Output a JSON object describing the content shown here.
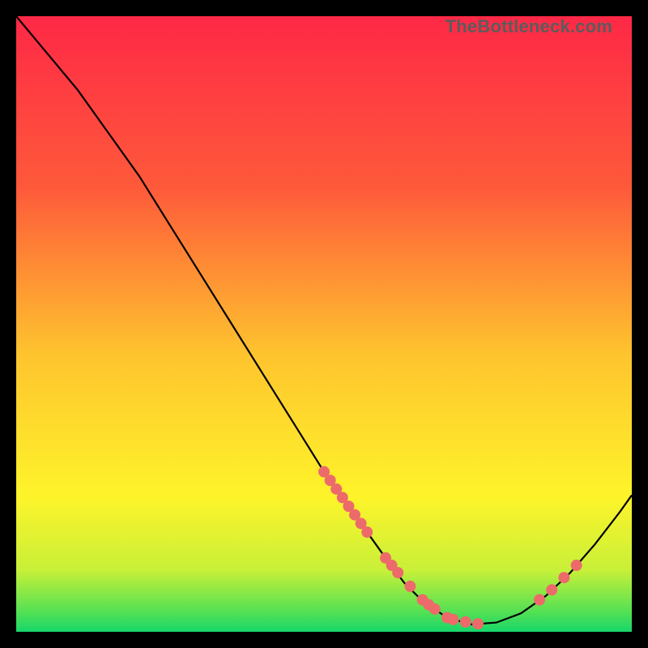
{
  "watermark": "TheBottleneck.com",
  "chart_data": {
    "type": "line",
    "title": "",
    "xlabel": "",
    "ylabel": "",
    "xlim": [
      0,
      100
    ],
    "ylim": [
      0,
      100
    ],
    "background_gradient": {
      "top": "#fe2846",
      "mid": "#fee22c",
      "bottom": "#17d66b"
    },
    "series": [
      {
        "name": "curve",
        "x": [
          0,
          5,
          10,
          15,
          20,
          25,
          30,
          35,
          40,
          45,
          50,
          55,
          60,
          63,
          66,
          70,
          74,
          78,
          82,
          86,
          90,
          94,
          98,
          100
        ],
        "y": [
          100,
          94,
          88,
          81,
          74,
          66,
          58,
          50,
          42,
          34,
          26,
          19,
          12,
          8,
          5,
          2.3,
          1.2,
          1.5,
          3.0,
          5.8,
          9.6,
          14.2,
          19.4,
          22.2
        ]
      }
    ],
    "markers": {
      "name": "points-on-curve",
      "x": [
        50,
        51,
        52,
        53,
        54,
        55,
        56,
        57,
        60,
        61,
        62,
        64,
        66,
        67,
        68,
        70,
        71,
        73,
        75,
        85,
        87,
        89,
        91
      ],
      "y": [
        26,
        24.6,
        23.2,
        21.8,
        20.4,
        19,
        17.6,
        16.2,
        12,
        10.8,
        9.6,
        7.4,
        5.2,
        4.4,
        3.7,
        2.3,
        2.0,
        1.6,
        1.3,
        5.2,
        6.8,
        8.8,
        10.8
      ]
    }
  }
}
